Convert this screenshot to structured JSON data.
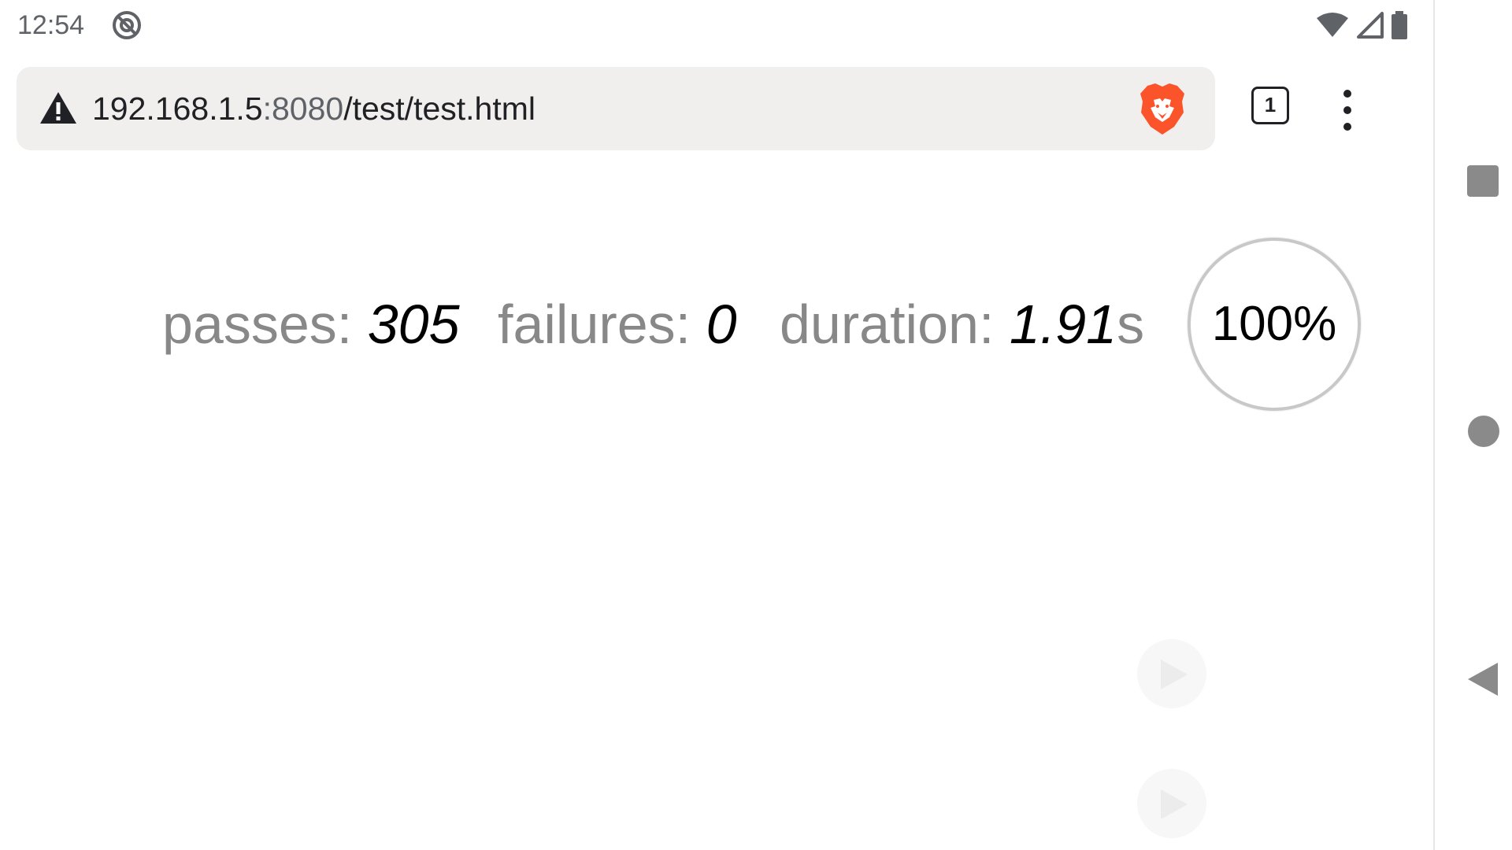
{
  "status_bar": {
    "time": "12:54",
    "icons": [
      "at-sign-icon",
      "wifi-icon",
      "cell-signal-icon",
      "battery-icon"
    ]
  },
  "browser": {
    "url_host": "192.168.1.5",
    "url_port": ":8080",
    "url_path": "/test/test.html",
    "security_icon": "warning-icon",
    "shields_icon": "brave-lion-icon",
    "tab_count": "1",
    "menu_icon": "kebab-menu-icon"
  },
  "mocha_stats": {
    "passes_label": "passes: ",
    "passes_value": "305",
    "failures_label": "failures: ",
    "failures_value": "0",
    "duration_label": "duration: ",
    "duration_value": "1.91",
    "duration_unit": "s",
    "progress_text": "100%"
  },
  "nav_bar": {
    "icons": [
      "recents-square-icon",
      "home-circle-icon",
      "back-triangle-icon"
    ]
  },
  "colors": {
    "label_gray": "#888888",
    "url_bar_bg": "#f1eeee",
    "brave_orange": "#fb542b"
  }
}
